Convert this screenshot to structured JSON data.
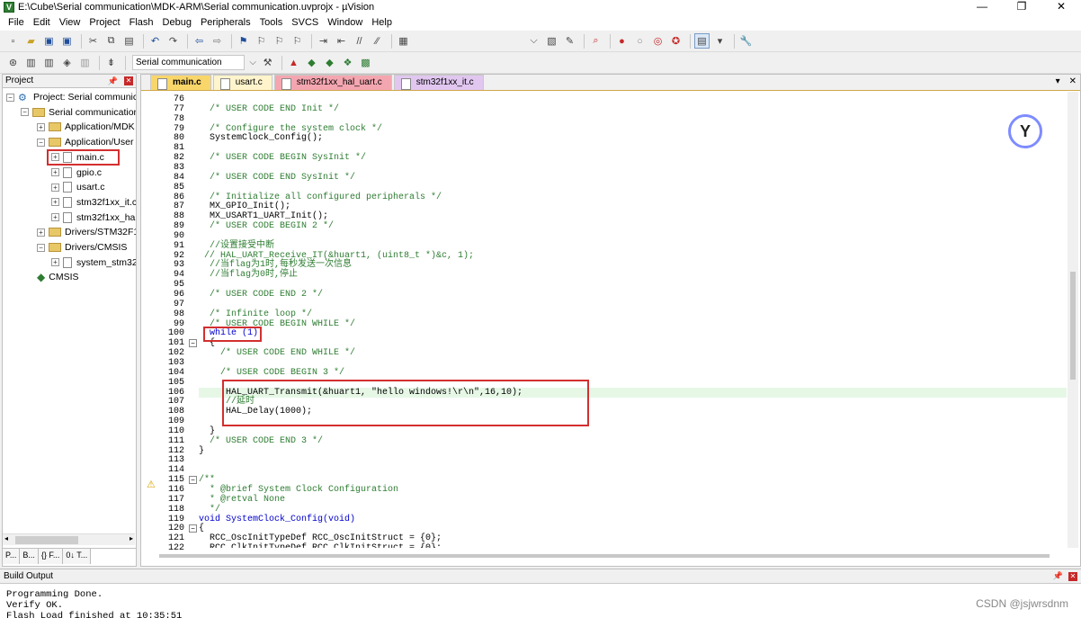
{
  "window": {
    "title": "E:\\Cube\\Serial communication\\MDK-ARM\\Serial communication.uvprojx - µVision",
    "app_icon_letter": "V",
    "minimize": "—",
    "restore": "❐",
    "close": "✕"
  },
  "menu": [
    "File",
    "Edit",
    "View",
    "Project",
    "Flash",
    "Debug",
    "Peripherals",
    "Tools",
    "SVCS",
    "Window",
    "Help"
  ],
  "toolbar": {
    "target_name": "Serial communication"
  },
  "project_panel": {
    "title": "Project",
    "pin": "📌",
    "close": "✕",
    "tree": [
      {
        "label": "Project: Serial communic",
        "level": 0,
        "exp": "−",
        "kind": "project"
      },
      {
        "label": "Serial communication",
        "level": 1,
        "exp": "−",
        "kind": "folder"
      },
      {
        "label": "Application/MDK",
        "level": 2,
        "exp": "+",
        "kind": "folder"
      },
      {
        "label": "Application/User",
        "level": 2,
        "exp": "−",
        "kind": "folder"
      },
      {
        "label": "main.c",
        "level": 3,
        "exp": "+",
        "kind": "file"
      },
      {
        "label": "gpio.c",
        "level": 3,
        "exp": "+",
        "kind": "file"
      },
      {
        "label": "usart.c",
        "level": 3,
        "exp": "+",
        "kind": "file"
      },
      {
        "label": "stm32f1xx_it.c",
        "level": 3,
        "exp": "+",
        "kind": "file"
      },
      {
        "label": "stm32f1xx_ha",
        "level": 3,
        "exp": "+",
        "kind": "file"
      },
      {
        "label": "Drivers/STM32F1x",
        "level": 2,
        "exp": "+",
        "kind": "folder"
      },
      {
        "label": "Drivers/CMSIS",
        "level": 2,
        "exp": "−",
        "kind": "folder"
      },
      {
        "label": "system_stm32",
        "level": 3,
        "exp": "+",
        "kind": "file"
      },
      {
        "label": "CMSIS",
        "level": 2,
        "exp": "",
        "kind": "cmsis"
      }
    ],
    "tabs": [
      "P...",
      "B...",
      "{} F...",
      "0↓ T..."
    ]
  },
  "editor": {
    "tabs": [
      "main.c",
      "usart.c",
      "stm32f1xx_hal_uart.c",
      "stm32f1xx_it.c"
    ],
    "tab_controls": [
      "▾",
      "✕"
    ],
    "warning_symbol": "⚠",
    "assistant_glyph": "Y",
    "line_numbers": [
      "76",
      "77",
      "78",
      "79",
      "80",
      "81",
      "82",
      "83",
      "84",
      "85",
      "86",
      "87",
      "88",
      "89",
      "90",
      "91",
      "92",
      "93",
      "94",
      "95",
      "96",
      "97",
      "98",
      "99",
      "100",
      "101",
      "102",
      "103",
      "104",
      "105",
      "106",
      "107",
      "108",
      "109",
      "110",
      "111",
      "112",
      "113",
      "114",
      "115",
      "116",
      "117",
      "118",
      "119",
      "120",
      "121",
      "122"
    ],
    "lines": [
      "",
      "  /* USER CODE END Init */",
      "",
      "  /* Configure the system clock */",
      "  SystemClock_Config();",
      "",
      "  /* USER CODE BEGIN SysInit */",
      "",
      "  /* USER CODE END SysInit */",
      "",
      "  /* Initialize all configured peripherals */",
      "  MX_GPIO_Init();",
      "  MX_USART1_UART_Init();",
      "  /* USER CODE BEGIN 2 */",
      "",
      "  //设置接受中断",
      " // HAL_UART_Receive_IT(&huart1, (uint8_t *)&c, 1);",
      "  //当flag为1时,每秒发送一次信息",
      "  //当flag为0时,停止",
      "",
      "  /* USER CODE END 2 */",
      "",
      "  /* Infinite loop */",
      "  /* USER CODE BEGIN WHILE */",
      "  while (1)",
      "  {",
      "    /* USER CODE END WHILE */",
      "",
      "    /* USER CODE BEGIN 3 */",
      "",
      "     HAL_UART_Transmit(&huart1, \"hello windows!\\r\\n\",16,10);",
      "     //延时",
      "     HAL_Delay(1000);",
      "",
      "  }",
      "  /* USER CODE END 3 */",
      "}",
      "",
      "",
      "/**",
      "  * @brief System Clock Configuration",
      "  * @retval None",
      "  */",
      "void SystemClock_Config(void)",
      "{",
      "  RCC_OscInitTypeDef RCC_OscInitStruct = {0};",
      "  RCC_ClkInitTypeDef RCC_ClkInitStruct = {0};"
    ],
    "line_styles": [
      "",
      "com",
      "",
      "com",
      "",
      "",
      "com",
      "",
      "com",
      "",
      "com",
      "",
      "",
      "com",
      "",
      "com",
      "com",
      "com",
      "com",
      "",
      "com",
      "",
      "com",
      "com",
      "kw",
      "",
      "com",
      "",
      "com",
      "",
      "cur",
      "com",
      "",
      "",
      "",
      "com",
      "",
      "",
      "",
      "com",
      "com",
      "com",
      "com",
      "kw",
      "",
      "",
      ""
    ],
    "fold_markers": [
      {
        "line": 101,
        "sign": "−"
      },
      {
        "line": 115,
        "sign": "−"
      },
      {
        "line": 120,
        "sign": "−"
      }
    ]
  },
  "build_output": {
    "title": "Build Output",
    "pin": "📌",
    "close": "✕",
    "lines": [
      "Programming Done.",
      "Verify OK.",
      "Flash Load finished at 10:35:51"
    ]
  },
  "watermark": "CSDN @jsjwrsdnm"
}
